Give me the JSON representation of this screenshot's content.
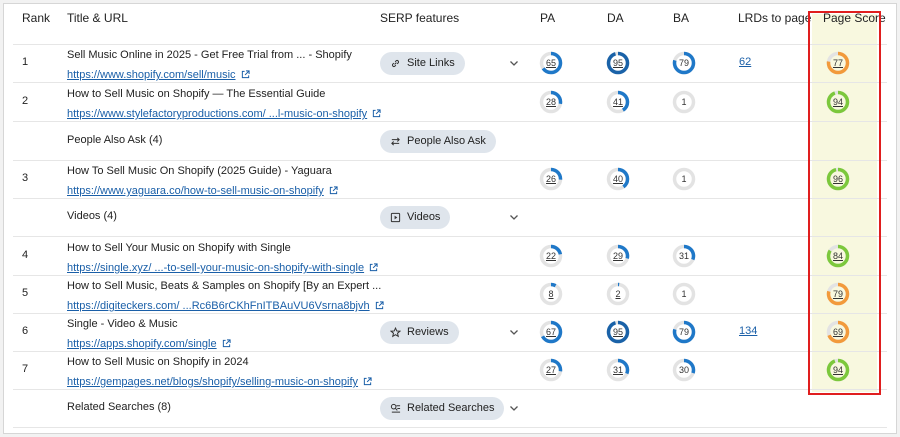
{
  "headers": {
    "rank": "Rank",
    "title_url": "Title & URL",
    "serp": "SERP features",
    "pa": "PA",
    "da": "DA",
    "ba": "BA",
    "lrds": "LRDs to page",
    "page_score": "Page Score"
  },
  "rows": [
    {
      "rank": "1",
      "title": "Sell Music Online in 2025 - Get Free Trial from ... - Shopify",
      "url": "https://www.shopify.com/sell/music",
      "serp": "Site Links",
      "serp_icon": "link-icon",
      "pa": "65",
      "da": "95",
      "ba": "79",
      "lrds": "62",
      "score": "77"
    },
    {
      "rank": "2",
      "title": "How to Sell Music on Shopify — The Essential Guide",
      "url": "https://www.stylefactoryproductions.com/ ...l-music-on-shopify",
      "pa": "28",
      "da": "41",
      "ba": "1",
      "score": "94"
    },
    {
      "group": "People Also Ask (4)",
      "serp": "People Also Ask",
      "serp_icon": "swap-icon"
    },
    {
      "rank": "3",
      "title": "How To Sell Music On Shopify (2025 Guide) - Yaguara",
      "url": "https://www.yaguara.co/how-to-sell-music-on-shopify",
      "pa": "26",
      "da": "40",
      "ba": "1",
      "score": "96"
    },
    {
      "group": "Videos (4)",
      "serp": "Videos",
      "serp_icon": "video-icon"
    },
    {
      "rank": "4",
      "title": "How to Sell Your Music on Shopify with Single",
      "url": "https://single.xyz/ ...-to-sell-your-music-on-shopify-with-single",
      "pa": "22",
      "da": "29",
      "ba": "31",
      "score": "84"
    },
    {
      "rank": "5",
      "title": "How to Sell Music, Beats & Samples on Shopify [By an Expert ...",
      "url": "https://digiteckers.com/ ...Rc6B6rCKhFnITBAuVU6Vsrna8bjvh",
      "pa": "8",
      "da": "2",
      "ba": "1",
      "score": "79"
    },
    {
      "rank": "6",
      "title": "Single - Video & Music",
      "url": "https://apps.shopify.com/single",
      "serp": "Reviews",
      "serp_icon": "star-icon",
      "pa": "67",
      "da": "95",
      "ba": "79",
      "lrds": "134",
      "score": "69"
    },
    {
      "rank": "7",
      "title": "How to Sell Music on Shopify in 2024",
      "url": "https://gempages.net/blogs/shopify/selling-music-on-shopify",
      "pa": "27",
      "da": "31",
      "ba": "30",
      "score": "94"
    },
    {
      "group": "Related Searches (8)",
      "serp": "Related Searches",
      "serp_icon": "search-list-icon"
    }
  ],
  "colors": {
    "ring_blue": "#1f78c8",
    "ring_blue_dark": "#1a62a8",
    "ring_track": "#e3e3e3",
    "score_green": "#7cc83c",
    "score_orange": "#f29a3b",
    "highlight_border": "#e01e1e",
    "highlight_bg": "#f8f8df"
  }
}
